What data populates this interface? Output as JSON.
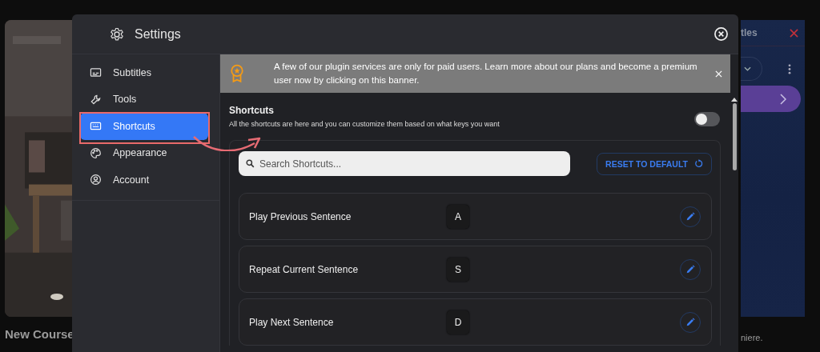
{
  "background": {
    "left_card": {
      "title": "New Course"
    },
    "right_panel": {
      "title": "tles",
      "footer": "niere."
    }
  },
  "dialog": {
    "title": "Settings",
    "nav": [
      {
        "label": "Subtitles",
        "selected": false
      },
      {
        "label": "Tools",
        "selected": false
      },
      {
        "label": "Shortcuts",
        "selected": true
      },
      {
        "label": "Appearance",
        "selected": false
      },
      {
        "label": "Account",
        "selected": false
      }
    ],
    "banner": {
      "text": "A few of our plugin services are only for paid users. Learn more about our plans and become a premium user now by clicking on this banner."
    },
    "section": {
      "title": "Shortcuts",
      "description": "All the shortcuts are here and you can customize them based on what keys you want",
      "toggle": {
        "on": false
      }
    },
    "search": {
      "placeholder": "Search Shortcuts..."
    },
    "reset_button": "RESET TO DEFAULT",
    "shortcuts": [
      {
        "action": "Play Previous Sentence",
        "key": "A"
      },
      {
        "action": "Repeat Current Sentence",
        "key": "S"
      },
      {
        "action": "Play Next Sentence",
        "key": "D"
      }
    ]
  }
}
